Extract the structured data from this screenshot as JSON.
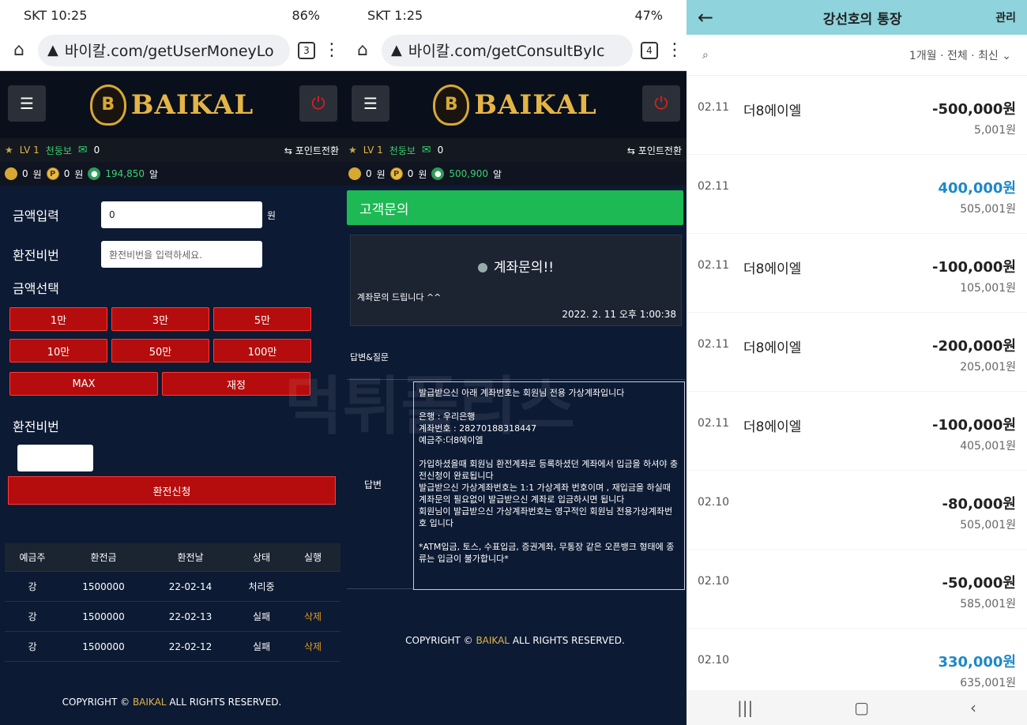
{
  "p1": {
    "status_carrier": "SKT",
    "status_time": "10:25",
    "status_battery": "86%",
    "url": "바이칼.com/getUserMoneyLo",
    "tab_count": "3",
    "user": {
      "level": "LV 1",
      "grade": "천둥보",
      "mail_count": "0",
      "point_convert": "포인트전환"
    },
    "money": {
      "won_value": "0",
      "won_unit": "원",
      "point_value": "0",
      "point_unit": "원",
      "chips_value": "194,850",
      "chips_unit": "알"
    },
    "form": {
      "amount_label": "금액입력",
      "amount_value": "0",
      "amount_unit": "원",
      "pw_label": "환전비번",
      "pw_placeholder": "환전비번을 입력하세요.",
      "select_label": "금액선택",
      "amounts": [
        "1만",
        "3만",
        "5만",
        "10만",
        "50만",
        "100만"
      ],
      "max_label": "MAX",
      "reset_label": "재정",
      "pw_label2": "환전비번",
      "submit_label": "환전신청"
    },
    "table": {
      "headers": [
        "예금주",
        "환전금",
        "환전날",
        "상태",
        "실행"
      ],
      "rows": [
        {
          "name": "강",
          "amount": "1500000",
          "date": "22-02-14",
          "status": "처리중",
          "action": ""
        },
        {
          "name": "강",
          "amount": "1500000",
          "date": "22-02-13",
          "status": "실패",
          "action": "삭제"
        },
        {
          "name": "강",
          "amount": "1500000",
          "date": "22-02-12",
          "status": "실패",
          "action": "삭제"
        }
      ]
    },
    "copyright_pre": "COPYRIGHT ©",
    "copyright_brand": "BAIKAL",
    "copyright_post": "ALL RIGHTS RESERVED."
  },
  "p2": {
    "status_carrier": "SKT",
    "status_time": "1:25",
    "status_battery": "47%",
    "url": "바이칼.com/getConsultByIc",
    "tab_count": "4",
    "user": {
      "level": "LV 1",
      "grade": "천둥보",
      "mail_count": "0",
      "point_convert": "포인트전환"
    },
    "money": {
      "won_value": "0",
      "won_unit": "원",
      "point_value": "0",
      "point_unit": "원",
      "chips_value": "500,900",
      "chips_unit": "알"
    },
    "cs_title": "고객문의",
    "subject": "계좌문의!!",
    "body": "계좌문의 드립니다 ^^",
    "date": "2022. 2. 11 오후 1:00:38",
    "answer_section": "답변&질문",
    "answer_key": "답변",
    "answer_text": "발급받으신 아래 계좌번호는 회원님 전용 가상계좌입니다\n\n은행 : 우리은행\n계좌번호 : 28270188318447\n예금주:더8에이엘\n\n가입하셨을때 회원님 환전계좌로 등록하셨던 계좌에서 입금을 하셔야 충전신청이 완료됩니다\n발급받으신 가상계좌번호는 1:1 가상계좌 번호이며 , 재입금을 하실때 계좌문의 필요없이 발급받으신 계좌로 입금하시면 됩니다\n회원님이 발급받으신 가상계좌번호는 영구적인 회원님 전용가상계좌번호 입니다\n\n*ATM입금, 토스, 수표입금, 증권계좌, 무통장 같은 오픈뱅크 형태에 종류는 입금이 불가합니다*",
    "copyright_pre": "COPYRIGHT ©",
    "copyright_brand": "BAIKAL",
    "copyright_post": "ALL RIGHTS RESERVED."
  },
  "p3": {
    "title": "강선호의 통장",
    "manage": "관리",
    "filter": "1개월 · 전체 · 최신",
    "transactions": [
      {
        "date": "02.11",
        "name": "더8에이엘",
        "amount": "-500,000원",
        "balance": "5,001원",
        "type": "minus"
      },
      {
        "date": "02.11",
        "name": "",
        "amount": "400,000원",
        "balance": "505,001원",
        "type": "plus"
      },
      {
        "date": "02.11",
        "name": "더8에이엘",
        "amount": "-100,000원",
        "balance": "105,001원",
        "type": "minus"
      },
      {
        "date": "02.11",
        "name": "더8에이엘",
        "amount": "-200,000원",
        "balance": "205,001원",
        "type": "minus"
      },
      {
        "date": "02.11",
        "name": "더8에이엘",
        "amount": "-100,000원",
        "balance": "405,001원",
        "type": "minus"
      },
      {
        "date": "02.10",
        "name": "",
        "amount": "-80,000원",
        "balance": "505,001원",
        "type": "minus"
      },
      {
        "date": "02.10",
        "name": "",
        "amount": "-50,000원",
        "balance": "585,001원",
        "type": "minus"
      },
      {
        "date": "02.10",
        "name": "",
        "amount": "330,000원",
        "balance": "635,001원",
        "type": "plus"
      }
    ]
  },
  "watermark": "먹튀폴리스"
}
